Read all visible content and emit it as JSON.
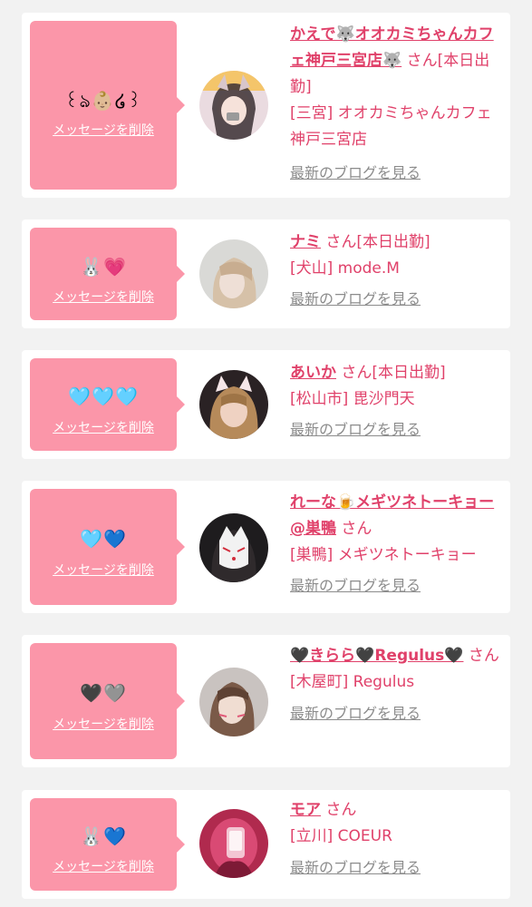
{
  "common": {
    "delete_label": "メッセージを削除",
    "blog_label": "最新のブログを見る",
    "san": "さん",
    "status_today": "[本日出勤]"
  },
  "colors": {
    "background": "#f2f2f2",
    "card": "#ffffff",
    "message_box": "#fb96a9",
    "accent": "#e0416a",
    "muted": "#8c8c8c"
  },
  "entries": [
    {
      "emoji": "꒰ঌ👶🏼໒꒱",
      "name": "かえで🐺オオカミちゃんカフェ神戸三宮店🐺",
      "shop": "[三宮] オオカミちゃんカフェ神戸三宮店",
      "avatar_icon": "girl-photo-icon"
    },
    {
      "emoji": "🐰💗",
      "name": "ナミ",
      "shop": "[犬山] mode.M",
      "avatar_icon": "girl-photo-icon"
    },
    {
      "emoji": "🩵🩵🩵",
      "name": "あいか",
      "shop": "[松山市] 毘沙門天",
      "avatar_icon": "girl-photo-icon"
    },
    {
      "emoji": "🩵💙",
      "name": "れーな🍺メギツネトーキョー@巣鴨",
      "shop": "[巣鴨] メギツネトーキョー",
      "avatar_icon": "girl-photo-icon"
    },
    {
      "emoji": "🖤🩶",
      "name": "🖤きらら🖤Regulus🖤",
      "shop": "[木屋町] Regulus",
      "avatar_icon": "girl-photo-icon"
    },
    {
      "emoji": "🐰💙",
      "name": "モア",
      "shop": "[立川] COEUR",
      "avatar_icon": "girl-photo-icon"
    }
  ]
}
